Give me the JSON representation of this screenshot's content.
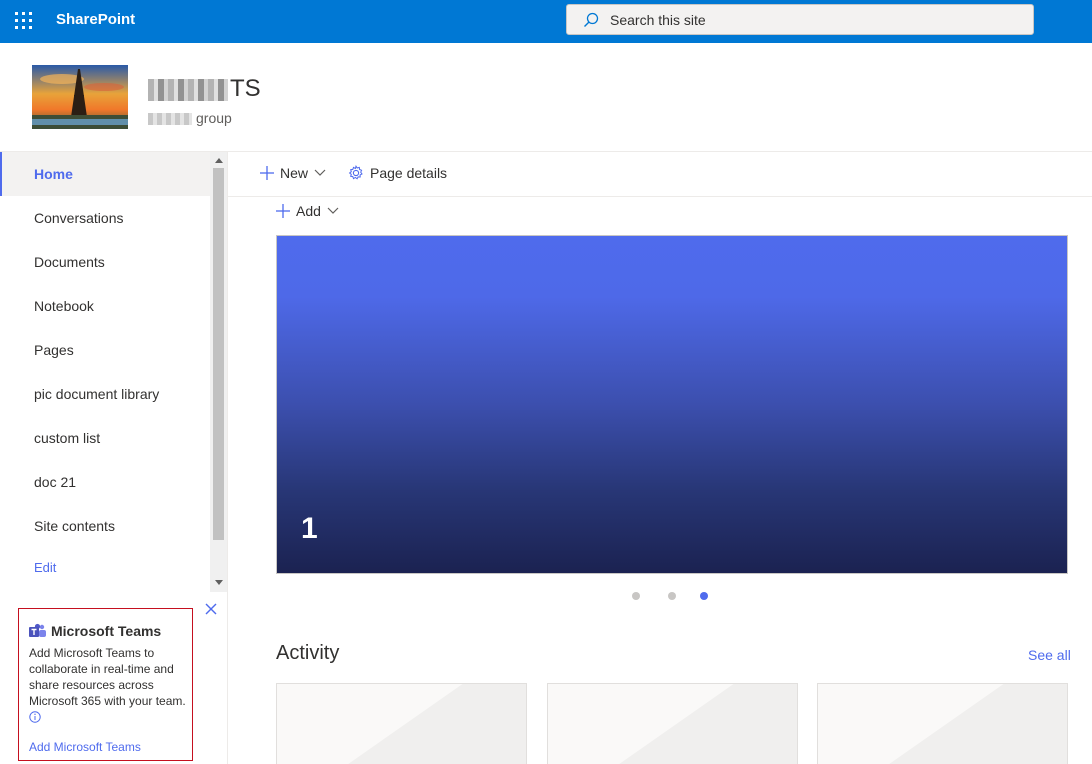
{
  "suitebar": {
    "brand": "SharePoint",
    "search_placeholder": "Search this site"
  },
  "site": {
    "title_visible": "TS",
    "subtitle_visible": "group"
  },
  "nav": {
    "items": [
      {
        "label": "Home",
        "active": true
      },
      {
        "label": "Conversations"
      },
      {
        "label": "Documents"
      },
      {
        "label": "Notebook"
      },
      {
        "label": "Pages"
      },
      {
        "label": "pic document library"
      },
      {
        "label": "custom list"
      },
      {
        "label": "doc 21"
      },
      {
        "label": "Site contents"
      }
    ],
    "edit_label": "Edit"
  },
  "teams_card": {
    "title": "Microsoft Teams",
    "description": "Add Microsoft Teams to collaborate in real-time and share resources across Microsoft 365 with your team.",
    "link_label": "Add Microsoft Teams"
  },
  "commandbar": {
    "new_label": "New",
    "page_details_label": "Page details"
  },
  "content": {
    "add_label": "Add",
    "hero_slide_label": "1",
    "carousel_current": 3,
    "carousel_total": 3,
    "activity_title": "Activity",
    "see_all_label": "See all"
  },
  "colors": {
    "suitebar": "#0078d4",
    "accent": "#4f6bed",
    "teams_card_border": "#c50f1f"
  }
}
